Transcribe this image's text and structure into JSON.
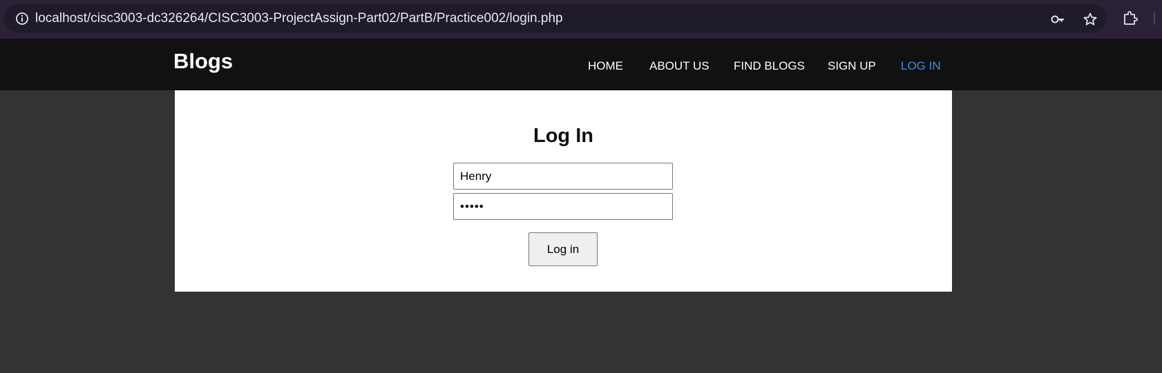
{
  "browser": {
    "url": "localhost/cisc3003-dc326264/CISC3003-ProjectAssign-Part02/PartB/Practice002/login.php",
    "icons": [
      "info-icon",
      "key-icon",
      "star-icon",
      "extensions-icon"
    ]
  },
  "navbar": {
    "brand": "Blogs",
    "links": [
      {
        "label": "HOME",
        "active": false
      },
      {
        "label": "ABOUT US",
        "active": false
      },
      {
        "label": "FIND BLOGS",
        "active": false
      },
      {
        "label": "SIGN UP",
        "active": false
      },
      {
        "label": "LOG IN",
        "active": true
      }
    ],
    "active_color": "#3d8fe0"
  },
  "login_form": {
    "title": "Log In",
    "username_value": "Henry",
    "password_value": "•••••",
    "submit_label": "Log in"
  }
}
